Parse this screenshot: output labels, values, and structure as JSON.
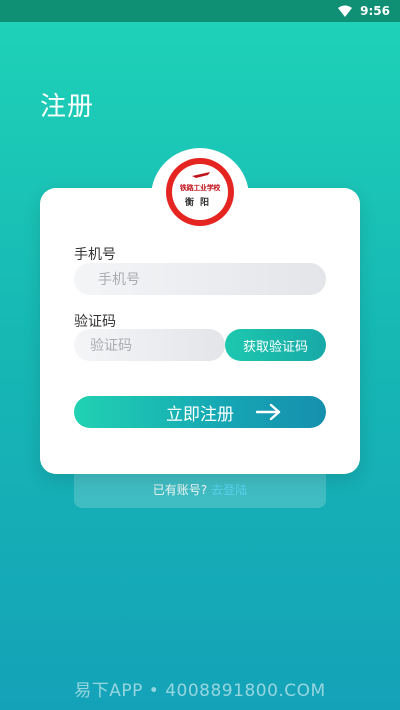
{
  "status_bar": {
    "time": "9:56"
  },
  "page": {
    "title": "注册"
  },
  "logo": {
    "school_name": "铁路工业学校",
    "city": "衡阳"
  },
  "form": {
    "phone_label": "手机号",
    "phone_placeholder": "手机号",
    "code_label": "验证码",
    "code_placeholder": "验证码",
    "get_code_button": "获取验证码",
    "submit_button": "立即注册"
  },
  "footer": {
    "has_account_text": "已有账号?",
    "login_link": "去登陆"
  },
  "watermark": "易下APP • 4008891800.COM",
  "colors": {
    "accent": "#1fd3b8",
    "brand_red": "#e52620",
    "link": "#5ad2ee"
  }
}
